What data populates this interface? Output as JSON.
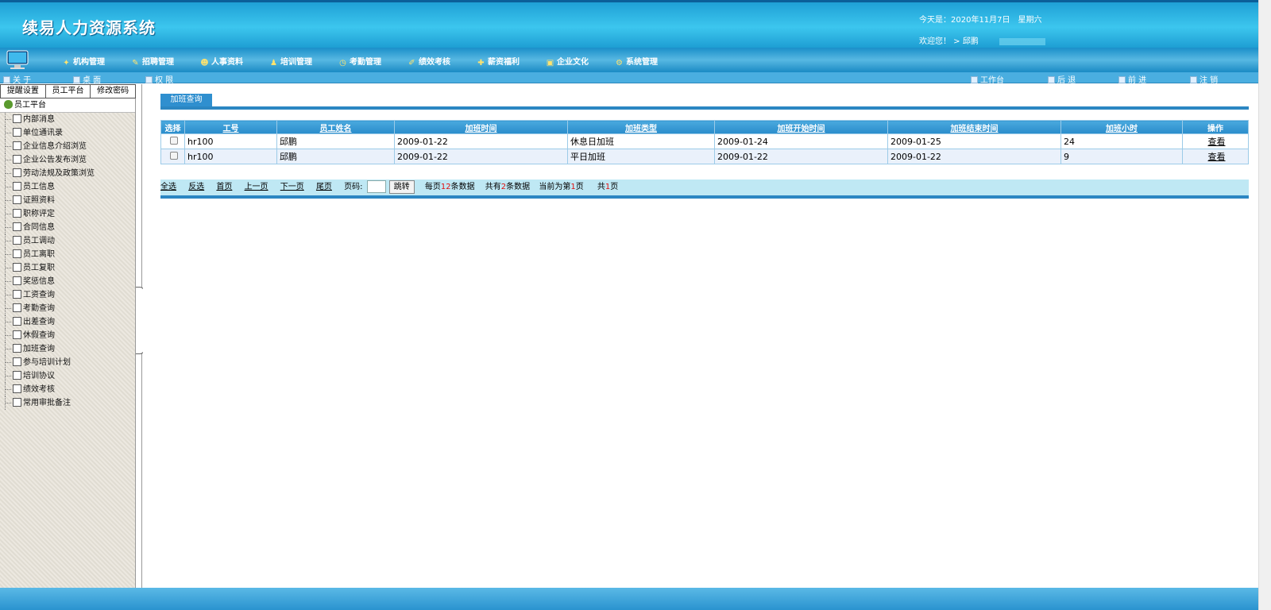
{
  "app": {
    "title": "续易人力资源系统",
    "date_text": "今天是：2020年11月7日　星期六",
    "welcome_text": "欢迎您！ > 邱鹏"
  },
  "menu": [
    {
      "label": "机构管理"
    },
    {
      "label": "招聘管理"
    },
    {
      "label": "人事资料"
    },
    {
      "label": "培训管理"
    },
    {
      "label": "考勤管理"
    },
    {
      "label": "绩效考核"
    },
    {
      "label": "薪资福利"
    },
    {
      "label": "企业文化"
    },
    {
      "label": "系统管理"
    }
  ],
  "subbar": {
    "about": "关 于",
    "desktop": "桌 面",
    "permission": "权 限",
    "workbench": "工作台",
    "back": "后 退",
    "forward": "前 进",
    "logout": "注 销"
  },
  "sidebar": {
    "tabs": [
      "提醒设置",
      "员工平台",
      "修改密码"
    ],
    "title": "员工平台",
    "items": [
      "内部消息",
      "单位通讯录",
      "企业信息介绍浏览",
      "企业公告发布浏览",
      "劳动法规及政策浏览",
      "员工信息",
      "证照资料",
      "职称评定",
      "合同信息",
      "员工调动",
      "员工离职",
      "员工复职",
      "奖惩信息",
      "工资查询",
      "考勤查询",
      "出差查询",
      "休假查询",
      "加班查询",
      "参与培训计划",
      "培训协议",
      "绩效考核",
      "常用审批备注"
    ]
  },
  "main": {
    "tab_label": "加班查询",
    "columns": [
      "选择",
      "工号",
      "员工姓名",
      "加班时间",
      "加班类型",
      "加班开始时间",
      "加班结束时间",
      "加班小时",
      "操作"
    ],
    "rows": [
      {
        "id": "hr100",
        "name": "邱鹏",
        "date": "2009-01-22",
        "type": "休息日加班",
        "start": "2009-01-24",
        "end": "2009-01-25",
        "hours": "24",
        "action": "查看"
      },
      {
        "id": "hr100",
        "name": "邱鹏",
        "date": "2009-01-22",
        "type": "平日加班",
        "start": "2009-01-22",
        "end": "2009-01-22",
        "hours": "9",
        "action": "查看"
      }
    ],
    "pager": {
      "select_all": "全选",
      "invert": "反选",
      "first": "首页",
      "prev": "上一页",
      "next": "下一页",
      "last": "尾页",
      "page_label": "页码:",
      "jump": "跳转",
      "per_page_pre": "每页",
      "per_page_num": "12",
      "per_page_post": "条数据",
      "total_pre": "共有",
      "total_num": "2",
      "total_post": "条数据",
      "current_pre": "当前为第",
      "current_num": "1",
      "current_post": "页",
      "pages_pre": "共",
      "pages_num": "1",
      "pages_post": "页"
    }
  },
  "colors": {
    "header": "#2fb4e4",
    "table_header": "#2a8ccb",
    "pager_bg": "#bfe8f4",
    "highlight": "#e01010"
  }
}
